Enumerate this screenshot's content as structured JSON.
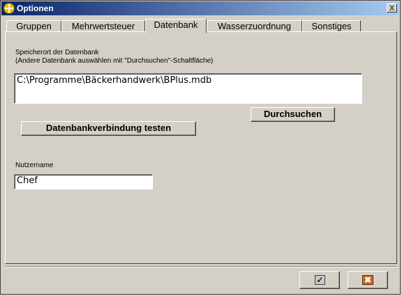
{
  "window": {
    "title": "Optionen",
    "close_symbol": "X"
  },
  "tabs": [
    {
      "label": "Gruppen"
    },
    {
      "label": "Mehrwertsteuer"
    },
    {
      "label": "Datenbank"
    },
    {
      "label": "Wasserzuordnung"
    },
    {
      "label": "Sonstiges"
    }
  ],
  "active_tab": "Datenbank",
  "database": {
    "label_line1": "Speicherort der Datenbank",
    "label_line2": "(Andere Datenbank auswählen mit \"Durchsuchen\"-Schaltfläche)",
    "path_value": "C:\\Programme\\Bäckerhandwerk\\BPlus.mdb",
    "browse_label": "Durchsuchen",
    "test_label": "Datenbankverbindung testen"
  },
  "user": {
    "label": "Nutzername",
    "value": "Chef"
  },
  "footer": {
    "ok_icon": "checkmark-icon",
    "cancel_icon": "cancel-x-icon",
    "ok_glyph": "✓",
    "cancel_glyph": "✖"
  },
  "colors": {
    "titlebar_start": "#0a246a",
    "titlebar_end": "#a6caf0",
    "face": "#d4d0c8",
    "cancel_icon": "#d2691e"
  }
}
